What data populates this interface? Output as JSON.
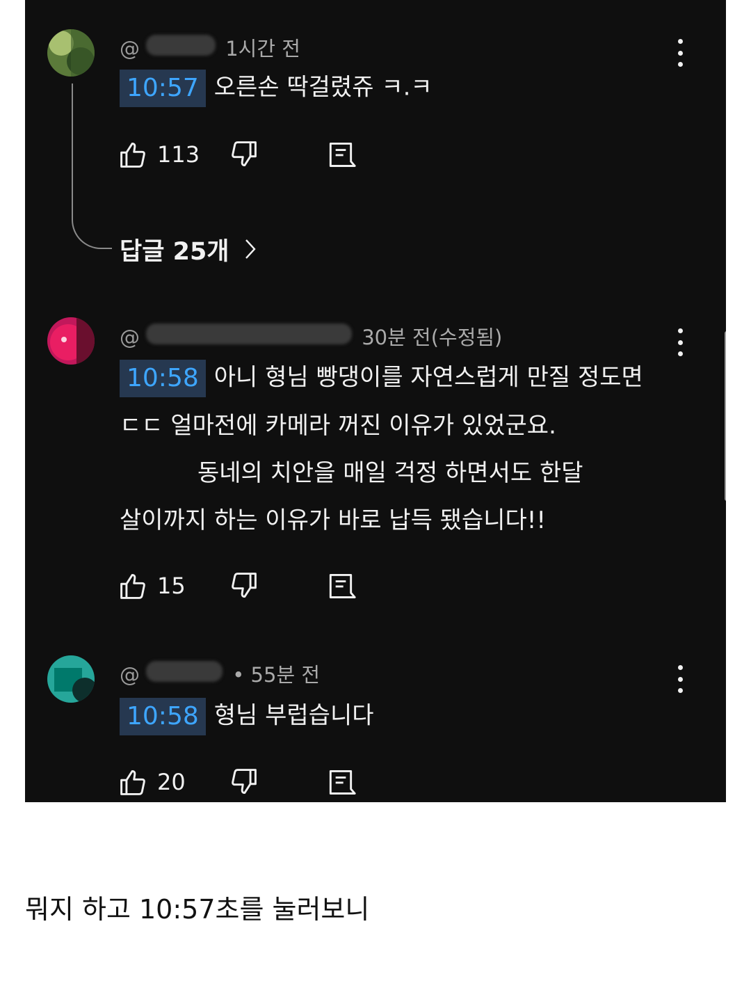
{
  "comments": [
    {
      "handle_prefix": "@",
      "time": "1시간 전",
      "timestamp_chip": "10:57",
      "lines": [
        "오른손 딱걸렸쥬 ㅋ.ㅋ"
      ],
      "likes": "113",
      "avatar_colors": [
        "#5b7a3a",
        "#a8c070",
        "#2e4a22"
      ],
      "replies_label": "답글 25개"
    },
    {
      "handle_prefix": "@",
      "time": "30분 전(수정됨)",
      "timestamp_chip": "10:58",
      "lines": [
        "아니 형님 빵댕이를 자연스럽게 만질 정도면",
        "ㄷㄷ 얼마전에 카메라 꺼진 이유가 있었군요.",
        "동네의 치안을 매일 걱정 하면서도 한달",
        "살이까지 하는 이유가 바로 납득 됐습니다!!"
      ],
      "likes": "15",
      "avatar_colors": [
        "#c2185b",
        "#e91e63",
        "#6a0f2e"
      ]
    },
    {
      "handle_prefix": "@",
      "time": "• 55분 전",
      "timestamp_chip": "10:58",
      "lines": [
        "형님 부럽습니다"
      ],
      "likes": "20",
      "avatar_colors": [
        "#26a69a",
        "#00796b",
        "#0d2f2c"
      ]
    }
  ],
  "icons": {
    "like": "thumbs-up-icon",
    "dislike": "thumbs-down-icon",
    "reply": "reply-icon",
    "menu": "more-vert-icon",
    "chevron": "chevron-right-icon"
  },
  "caption": "뭐지 하고 10:57초를 눌러보니",
  "colors": {
    "background": "#0f0f0f",
    "timestamp_chip_bg": "#263850",
    "timestamp_chip_text": "#3ea6ff"
  }
}
